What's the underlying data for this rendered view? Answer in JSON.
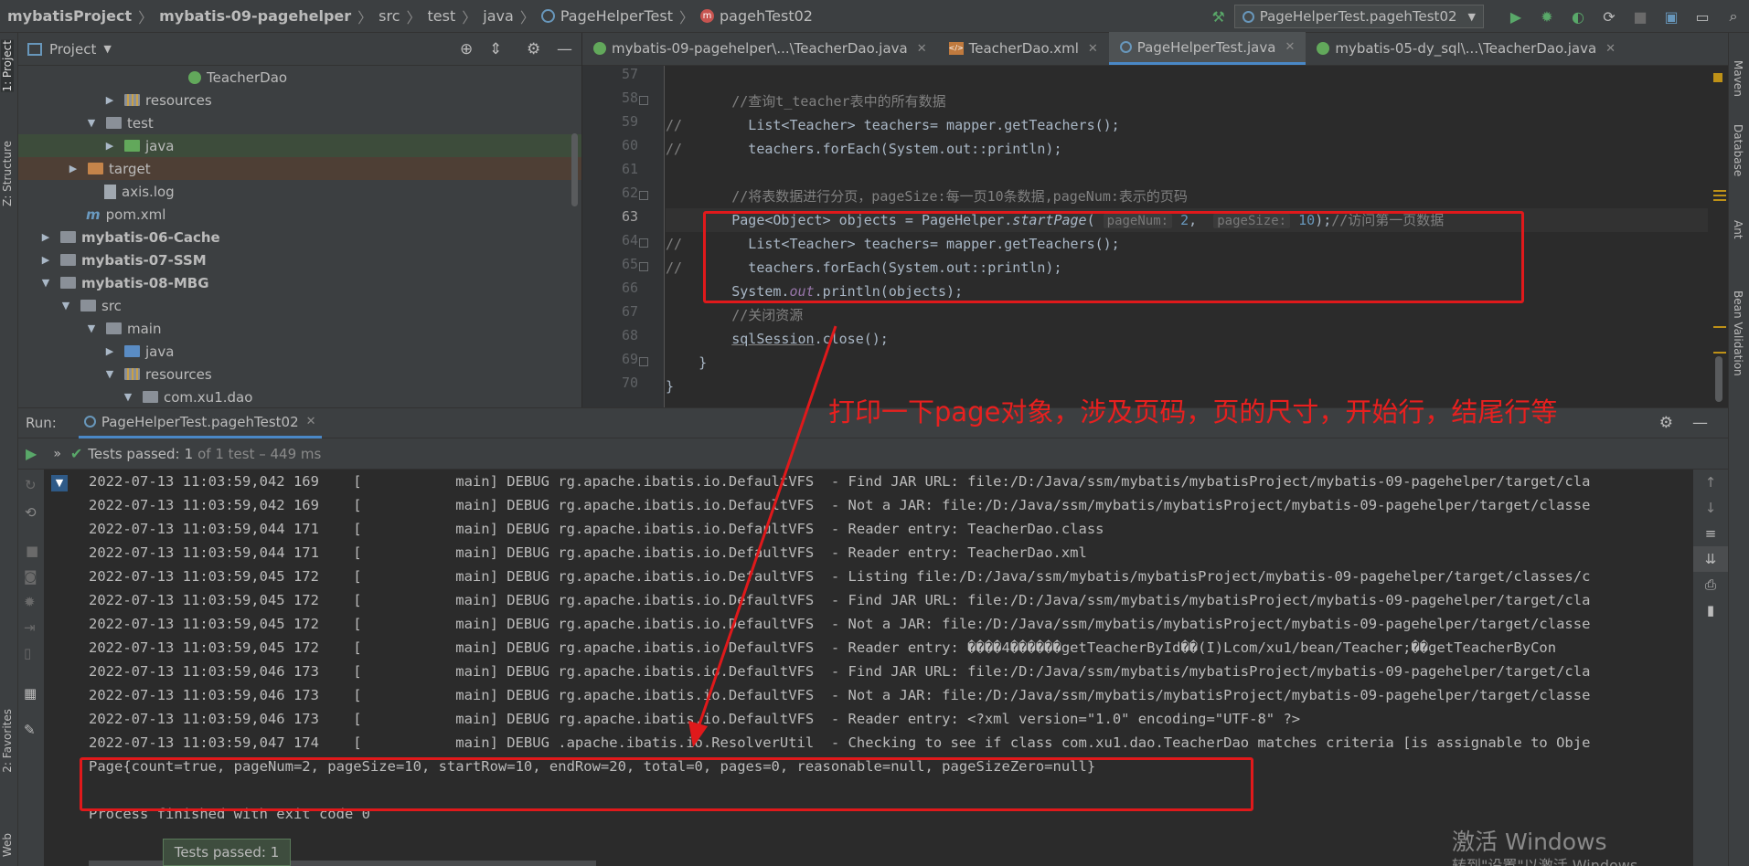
{
  "breadcrumbs": [
    "mybatisProject",
    "mybatis-09-pagehelper",
    "src",
    "test",
    "java",
    "PageHelperTest",
    "pagehTest02"
  ],
  "run_config": "PageHelperTest.pagehTest02",
  "left_strip": {
    "project": "1: Project",
    "structure": "Z: Structure",
    "favorites": "2: Favorites",
    "web": "Web"
  },
  "right_strip": {
    "maven": "Maven",
    "database": "Database",
    "ant": "Ant",
    "bean_validation": "Bean Validation"
  },
  "project_panel": {
    "title": "Project",
    "rows": [
      {
        "label": "TeacherDao"
      },
      {
        "label": "resources"
      },
      {
        "label": "test"
      },
      {
        "label": "java"
      },
      {
        "label": "target"
      },
      {
        "label": "axis.log"
      },
      {
        "label": "pom.xml"
      },
      {
        "label": "mybatis-06-Cache"
      },
      {
        "label": "mybatis-07-SSM"
      },
      {
        "label": "mybatis-08-MBG"
      },
      {
        "label": "src"
      },
      {
        "label": "main"
      },
      {
        "label": "java"
      },
      {
        "label": "resources"
      },
      {
        "label": "com.xu1.dao"
      }
    ]
  },
  "tabs": [
    {
      "label": "mybatis-09-pagehelper\\...\\TeacherDao.java"
    },
    {
      "label": "TeacherDao.xml"
    },
    {
      "label": "PageHelperTest.java"
    },
    {
      "label": "mybatis-05-dy_sql\\...\\TeacherDao.java"
    }
  ],
  "code": {
    "line_numbers": [
      "57",
      "58",
      "59",
      "60",
      "61",
      "62",
      "63",
      "64",
      "65",
      "66",
      "67",
      "68",
      "69",
      "70"
    ],
    "l58": "//查询t_teacher表中的所有数据",
    "l59": "        List<Teacher> teachers= mapper.getTeachers();",
    "l60": "        teachers.forEach(System.out::println);",
    "l62": "//将表数据进行分页，pageSize:每一页10条数据,pageNum:表示的页码",
    "l63_a": "Page<Object> objects = PageHelper.",
    "l63_method": "startPage",
    "l63_b": "( ",
    "l63_hint1": "pageNum:",
    "l63_num1": "2",
    "l63_c": ",  ",
    "l63_hint2": "pageSize:",
    "l63_num2": "10",
    "l63_d": ");",
    "l63_comment": "//访问第一页数据",
    "l64": "        List<Teacher> teachers= mapper.getTeachers();",
    "l65": "        teachers.forEach(System.out::println);",
    "l66_a": "System.",
    "l66_out": "out",
    "l66_b": ".println(objects);",
    "l67": "//关闭资源",
    "l68_a": "sqlSession",
    "l68_b": ".close();",
    "l69": "}",
    "l70": "}"
  },
  "annotation": "打印一下page对象，涉及页码，页的尺寸，开始行，结尾行等",
  "run_panel": {
    "label": "Run:",
    "tab": "PageHelperTest.pagehTest02",
    "status_main": "Tests passed:",
    "status_count": "1",
    "status_rest": "of 1 test – 449 ms",
    "logs": [
      "2022-07-13 11:03:59,042 169    [           main] DEBUG rg.apache.ibatis.io.DefaultVFS  - Find JAR URL: file:/D:/Java/ssm/mybatis/mybatisProject/mybatis-09-pagehelper/target/cla",
      "2022-07-13 11:03:59,042 169    [           main] DEBUG rg.apache.ibatis.io.DefaultVFS  - Not a JAR: file:/D:/Java/ssm/mybatis/mybatisProject/mybatis-09-pagehelper/target/classe",
      "2022-07-13 11:03:59,044 171    [           main] DEBUG rg.apache.ibatis.io.DefaultVFS  - Reader entry: TeacherDao.class",
      "2022-07-13 11:03:59,044 171    [           main] DEBUG rg.apache.ibatis.io.DefaultVFS  - Reader entry: TeacherDao.xml",
      "2022-07-13 11:03:59,045 172    [           main] DEBUG rg.apache.ibatis.io.DefaultVFS  - Listing file:/D:/Java/ssm/mybatis/mybatisProject/mybatis-09-pagehelper/target/classes/c",
      "2022-07-13 11:03:59,045 172    [           main] DEBUG rg.apache.ibatis.io.DefaultVFS  - Find JAR URL: file:/D:/Java/ssm/mybatis/mybatisProject/mybatis-09-pagehelper/target/cla",
      "2022-07-13 11:03:59,045 172    [           main] DEBUG rg.apache.ibatis.io.DefaultVFS  - Not a JAR: file:/D:/Java/ssm/mybatis/mybatisProject/mybatis-09-pagehelper/target/classe",
      "2022-07-13 11:03:59,045 172    [           main] DEBUG rg.apache.ibatis.io.DefaultVFS  - Reader entry: ����4������getTeacherById��(I)Lcom/xu1/bean/Teacher;��getTeacherByCon",
      "2022-07-13 11:03:59,046 173    [           main] DEBUG rg.apache.ibatis.io.DefaultVFS  - Find JAR URL: file:/D:/Java/ssm/mybatis/mybatisProject/mybatis-09-pagehelper/target/cla",
      "2022-07-13 11:03:59,046 173    [           main] DEBUG rg.apache.ibatis.io.DefaultVFS  - Not a JAR: file:/D:/Java/ssm/mybatis/mybatisProject/mybatis-09-pagehelper/target/classe",
      "2022-07-13 11:03:59,046 173    [           main] DEBUG rg.apache.ibatis.io.DefaultVFS  - Reader entry: <?xml version=\"1.0\" encoding=\"UTF-8\" ?>",
      "2022-07-13 11:03:59,047 174    [           main] DEBUG .apache.ibatis.io.ResolverUtil  - Checking to see if class com.xu1.dao.TeacherDao matches criteria [is assignable to Obje"
    ],
    "page_output": "Page{count=true, pageNum=2, pageSize=10, startRow=10, endRow=20, total=0, pages=0, reasonable=null, pageSizeZero=null}",
    "exit": "Process finished with exit code 0"
  },
  "toast": "Tests passed: 1",
  "watermark": {
    "line1": "激活 Windows",
    "line2": "转到\"设置\"以激活 Windows"
  }
}
